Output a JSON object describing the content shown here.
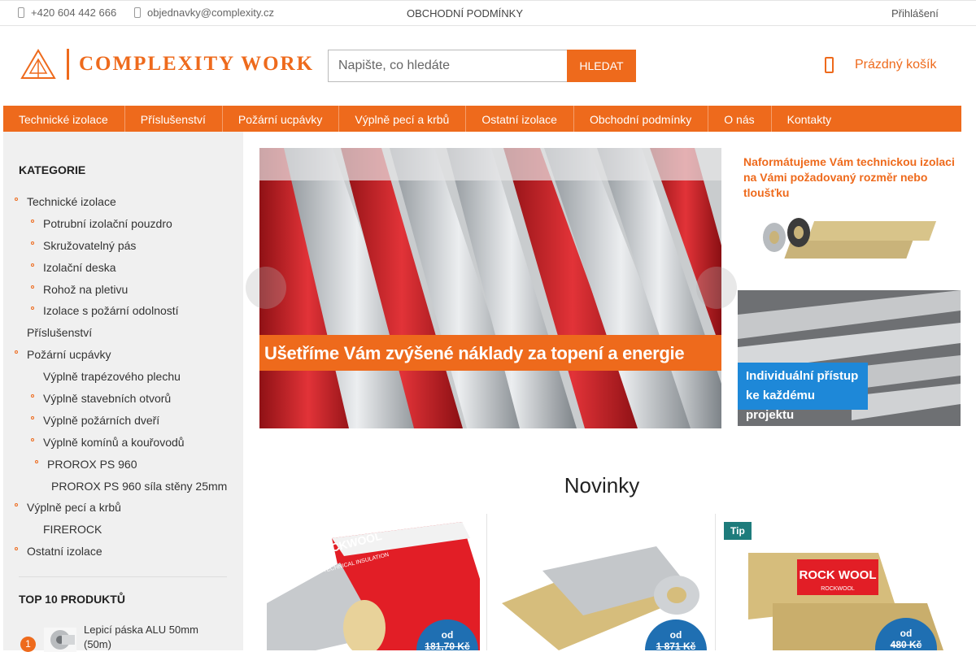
{
  "topbar": {
    "phone": "+420 604 442 666",
    "email": "objednavky@complexity.cz",
    "terms": "OBCHODNÍ PODMÍNKY",
    "login": "Přihlášení"
  },
  "header": {
    "logo_text": "COMPLEXITY WORK",
    "search_placeholder": "Napište, co hledáte",
    "search_button": "HLEDAT",
    "cart_label": "Prázdný košík"
  },
  "nav": [
    "Technické izolace",
    "Příslušenství",
    "Požární ucpávky",
    "Výplně pecí a krbů",
    "Ostatní izolace",
    "Obchodní podmínky",
    "O nás",
    "Kontakty"
  ],
  "sidebar": {
    "heading": "KATEGORIE",
    "items": [
      {
        "label": "Technické izolace",
        "level": 0,
        "dot": true
      },
      {
        "label": "Potrubní izolační pouzdro",
        "level": 1,
        "dot": true
      },
      {
        "label": "Skružovatelný pás",
        "level": 1,
        "dot": true
      },
      {
        "label": "Izolační deska",
        "level": 1,
        "dot": true
      },
      {
        "label": "Rohož na pletivu",
        "level": 1,
        "dot": true
      },
      {
        "label": "Izolace s požární odolností",
        "level": 1,
        "dot": true
      },
      {
        "label": "Příslušenství",
        "level": 0,
        "dot": false
      },
      {
        "label": "Požární ucpávky",
        "level": 0,
        "dot": true
      },
      {
        "label": "Výplně trapézového plechu",
        "level": 1,
        "dot": false
      },
      {
        "label": "Výplně stavebních otvorů",
        "level": 1,
        "dot": true
      },
      {
        "label": "Výplně požárních dveří",
        "level": 1,
        "dot": true
      },
      {
        "label": "Výplně komínů a kouřovodů",
        "level": 1,
        "dot": true
      },
      {
        "label": "PROROX PS 960",
        "level": 2,
        "dot": true
      },
      {
        "label": "PROROX PS 960 síla stěny 25mm",
        "level": 3,
        "dot": false
      },
      {
        "label": "Výplně pecí a krbů",
        "level": 0,
        "dot": true
      },
      {
        "label": "FIREROCK",
        "level": 1,
        "dot": false
      },
      {
        "label": "Ostatní izolace",
        "level": 0,
        "dot": true
      }
    ],
    "top_heading": "TOP 10 PRODUKTŮ",
    "top_items": [
      {
        "rank": "1",
        "name": "Lepicí páska ALU 50mm (50m)"
      }
    ]
  },
  "banners": {
    "main_caption": "Ušetříme Vám zvýšené náklady za topení a energie",
    "side1_text": "Naformátujeme Vám technickou izolaci na Vámi požadovaný rozměr nebo tloušťku",
    "side2_line1": "Individuální přístup",
    "side2_line2": "ke každému projektu"
  },
  "novinky": {
    "heading": "Novinky",
    "products": [
      {
        "prefix": "od",
        "price": "181,70 Kč",
        "tag": "",
        "brand": "ROCKWOOL",
        "brand_sub": "TECHNICAL INSULATION"
      },
      {
        "prefix": "od",
        "price": "1 871 Kč",
        "tag": "",
        "brand": "",
        "brand_sub": ""
      },
      {
        "prefix": "od",
        "price": "480 Kč",
        "tag": "Tip",
        "brand": "ROCK WOOL",
        "brand_sub": "ROCKWOOL"
      }
    ]
  },
  "colors": {
    "accent": "#ee6a1c",
    "price_badge": "#1f6fb2",
    "tip_badge": "#1e7c7c",
    "sidebar_bg": "#f0f0f0"
  }
}
